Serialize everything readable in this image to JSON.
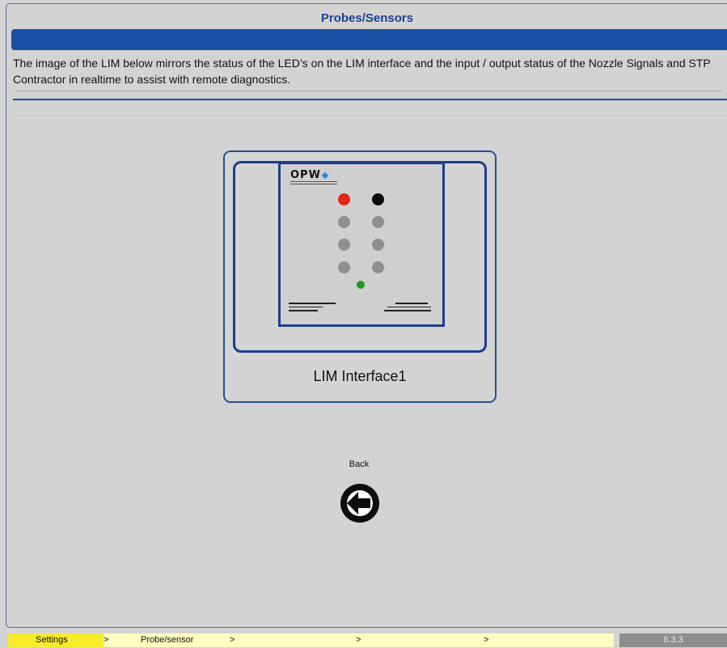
{
  "header": {
    "title": "Probes/Sensors",
    "description": "The image of the LIM below mirrors the status of the LED’s on the LIM interface and the input / output status of the Nozzle Signals and STP Contractor in realtime to assist with remote diagnostics."
  },
  "lim": {
    "logo_text": "OPW",
    "label": "LIM Interface1",
    "leds": [
      {
        "name": "led-1",
        "color": "#e3251b",
        "state": "red"
      },
      {
        "name": "led-2",
        "color": "#0a0a0a",
        "state": "black"
      },
      {
        "name": "led-3",
        "color": "#8f8f8f",
        "state": "off"
      },
      {
        "name": "led-4",
        "color": "#8f8f8f",
        "state": "off"
      },
      {
        "name": "led-5",
        "color": "#8f8f8f",
        "state": "off"
      },
      {
        "name": "led-6",
        "color": "#8f8f8f",
        "state": "off"
      },
      {
        "name": "led-7",
        "color": "#8f8f8f",
        "state": "off"
      },
      {
        "name": "led-8",
        "color": "#8f8f8f",
        "state": "off"
      },
      {
        "name": "power-led",
        "color": "#1e9b22",
        "state": "on"
      }
    ]
  },
  "back": {
    "label": "Back",
    "icon": "arrow-left-circle-icon"
  },
  "footer": {
    "breadcrumbs": [
      "Settings",
      ">",
      "Probe/sensor",
      ">",
      ">",
      ">"
    ],
    "version": "6.3.3"
  },
  "colors": {
    "accent": "#1b4fa3",
    "title": "#1f3f8f",
    "breadcrumb_active": "#f6ec2a",
    "breadcrumb_bg": "#fffcbf"
  }
}
